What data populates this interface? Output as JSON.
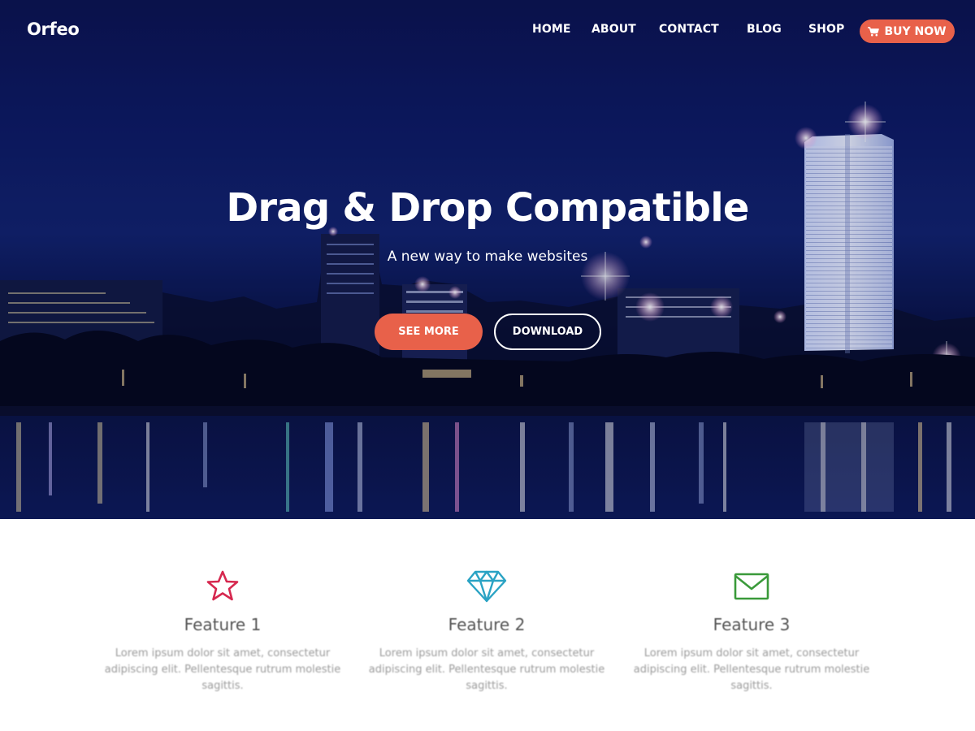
{
  "nav": {
    "brand": "Orfeo",
    "links": [
      {
        "label": "HOME"
      },
      {
        "label": "ABOUT"
      },
      {
        "label": "CONTACT"
      },
      {
        "label": "BLOG"
      },
      {
        "label": "SHOP"
      }
    ],
    "buy_label": "BUY NOW",
    "buy_icon": "shopping-cart-icon"
  },
  "hero": {
    "title": "Drag & Drop Compatible",
    "subtitle": "A new way to make websites",
    "primary_button": "SEE MORE",
    "secondary_button": "DOWNLOAD",
    "accent_color": "#e8614a"
  },
  "features": [
    {
      "icon": "star-icon",
      "icon_color": "#d6284f",
      "title": "Feature 1",
      "desc": "Lorem ipsum dolor sit amet, consectetur adipiscing elit. Pellentesque rutrum molestie sagittis."
    },
    {
      "icon": "diamond-icon",
      "icon_color": "#2aa3c4",
      "title": "Feature 2",
      "desc": "Lorem ipsum dolor sit amet, consectetur adipiscing elit. Pellentesque rutrum molestie sagittis."
    },
    {
      "icon": "envelope-icon",
      "icon_color": "#3a9a3a",
      "title": "Feature 3",
      "desc": "Lorem ipsum dolor sit amet, consectetur adipiscing elit. Pellentesque rutrum molestie sagittis."
    }
  ]
}
